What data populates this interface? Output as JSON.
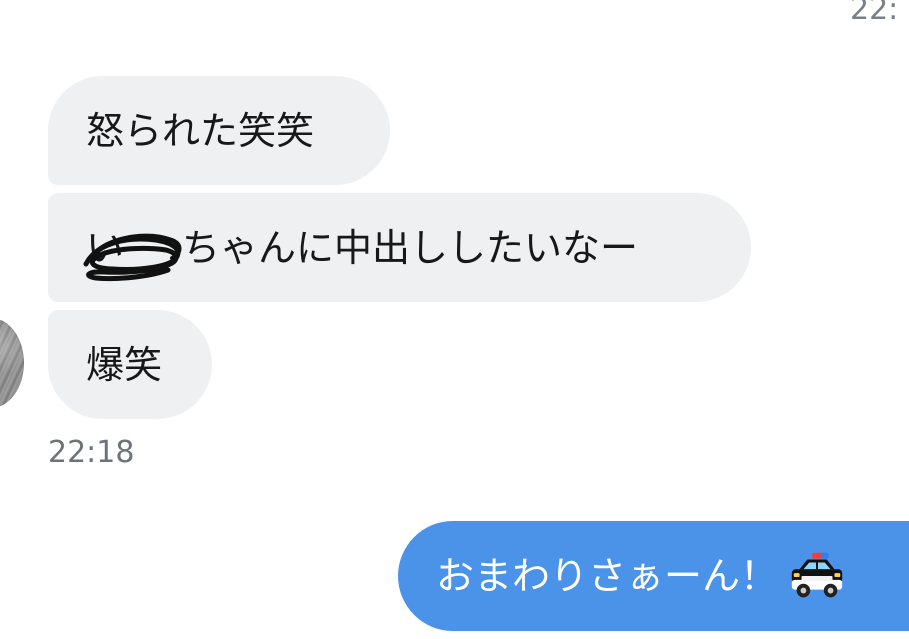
{
  "top_timestamp": "22:",
  "messages": {
    "received": [
      {
        "text": "怒られた笑笑"
      },
      {
        "prefix": "い",
        "text": "ちゃんに中出ししたいなー"
      },
      {
        "text": "爆笑"
      }
    ],
    "received_time": "22:18",
    "sent": {
      "text": "おまわりさぁーん！",
      "emoji": "police-car"
    }
  },
  "colors": {
    "received_bubble": "#eef0f1",
    "sent_bubble": "#4a93e8",
    "timestamp": "#6e737a"
  }
}
